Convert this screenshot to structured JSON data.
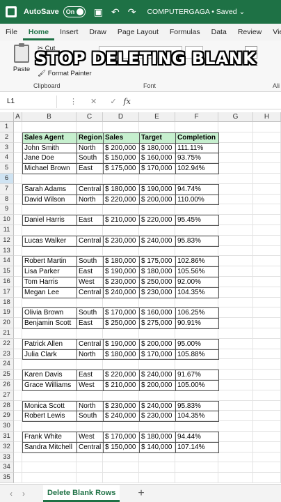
{
  "titlebar": {
    "autosave": "AutoSave",
    "toggle": "On",
    "title": "COMPUTERGAGA • Saved ⌄"
  },
  "menu": {
    "tabs": [
      "File",
      "Home",
      "Insert",
      "Draw",
      "Page Layout",
      "Formulas",
      "Data",
      "Review",
      "View"
    ],
    "active": "Home"
  },
  "ribbon": {
    "paste": "Paste",
    "cut": "Cut",
    "format_painter": "Format Painter",
    "clipboard": "Clipboard",
    "font": "Font",
    "alignment": "Ali",
    "overlay_text": "STOP DELETING BLANK"
  },
  "formula_bar": {
    "name_box": "L1",
    "fx": "fx"
  },
  "columns": [
    "A",
    "B",
    "C",
    "D",
    "E",
    "F",
    "G",
    "H"
  ],
  "headers": [
    "Sales Agent",
    "Region",
    "Sales",
    "Target",
    "Completion"
  ],
  "rows": [
    {
      "n": 1,
      "blank": true
    },
    {
      "n": 2,
      "header": true
    },
    {
      "n": 3,
      "agent": "John Smith",
      "region": "North",
      "sales": "$ 200,000",
      "target": "$ 180,000",
      "completion": "111.11%"
    },
    {
      "n": 4,
      "agent": "Jane Doe",
      "region": "South",
      "sales": "$ 150,000",
      "target": "$ 160,000",
      "completion": "93.75%"
    },
    {
      "n": 5,
      "agent": "Michael Brown",
      "region": "East",
      "sales": "$ 175,000",
      "target": "$ 170,000",
      "completion": "102.94%"
    },
    {
      "n": 6,
      "blank": true
    },
    {
      "n": 7,
      "agent": "Sarah Adams",
      "region": "Central",
      "sales": "$ 180,000",
      "target": "$ 190,000",
      "completion": "94.74%"
    },
    {
      "n": 8,
      "agent": "David Wilson",
      "region": "North",
      "sales": "$ 220,000",
      "target": "$ 200,000",
      "completion": "110.00%"
    },
    {
      "n": 9,
      "blank": true
    },
    {
      "n": 10,
      "agent": "Daniel Harris",
      "region": "East",
      "sales": "$ 210,000",
      "target": "$ 220,000",
      "completion": "95.45%"
    },
    {
      "n": 11,
      "blank": true
    },
    {
      "n": 12,
      "agent": "Lucas Walker",
      "region": "Central",
      "sales": "$ 230,000",
      "target": "$ 240,000",
      "completion": "95.83%"
    },
    {
      "n": 13,
      "blank": true
    },
    {
      "n": 14,
      "agent": "Robert Martin",
      "region": "South",
      "sales": "$ 180,000",
      "target": "$ 175,000",
      "completion": "102.86%"
    },
    {
      "n": 15,
      "agent": "Lisa Parker",
      "region": "East",
      "sales": "$ 190,000",
      "target": "$ 180,000",
      "completion": "105.56%"
    },
    {
      "n": 16,
      "agent": "Tom Harris",
      "region": "West",
      "sales": "$ 230,000",
      "target": "$ 250,000",
      "completion": "92.00%"
    },
    {
      "n": 17,
      "agent": "Megan Lee",
      "region": "Central",
      "sales": "$ 240,000",
      "target": "$ 230,000",
      "completion": "104.35%"
    },
    {
      "n": 18,
      "blank": true
    },
    {
      "n": 19,
      "agent": "Olivia Brown",
      "region": "South",
      "sales": "$ 170,000",
      "target": "$ 160,000",
      "completion": "106.25%"
    },
    {
      "n": 20,
      "agent": "Benjamin Scott",
      "region": "East",
      "sales": "$ 250,000",
      "target": "$ 275,000",
      "completion": "90.91%"
    },
    {
      "n": 21,
      "blank": true
    },
    {
      "n": 22,
      "agent": "Patrick Allen",
      "region": "Central",
      "sales": "$ 190,000",
      "target": "$ 200,000",
      "completion": "95.00%"
    },
    {
      "n": 23,
      "agent": "Julia Clark",
      "region": "North",
      "sales": "$ 180,000",
      "target": "$ 170,000",
      "completion": "105.88%"
    },
    {
      "n": 24,
      "blank": true
    },
    {
      "n": 25,
      "agent": "Karen Davis",
      "region": "East",
      "sales": "$ 220,000",
      "target": "$ 240,000",
      "completion": "91.67%"
    },
    {
      "n": 26,
      "agent": "Grace Williams",
      "region": "West",
      "sales": "$ 210,000",
      "target": "$ 200,000",
      "completion": "105.00%"
    },
    {
      "n": 27,
      "blank": true
    },
    {
      "n": 28,
      "agent": "Monica Scott",
      "region": "North",
      "sales": "$ 230,000",
      "target": "$ 240,000",
      "completion": "95.83%"
    },
    {
      "n": 29,
      "agent": "Robert Lewis",
      "region": "South",
      "sales": "$ 240,000",
      "target": "$ 230,000",
      "completion": "104.35%"
    },
    {
      "n": 30,
      "blank": true
    },
    {
      "n": 31,
      "agent": "Frank White",
      "region": "West",
      "sales": "$ 170,000",
      "target": "$ 180,000",
      "completion": "94.44%"
    },
    {
      "n": 32,
      "agent": "Sandra Mitchell",
      "region": "Central",
      "sales": "$ 150,000",
      "target": "$ 140,000",
      "completion": "107.14%"
    },
    {
      "n": 33,
      "blank": true
    },
    {
      "n": 34,
      "blank": true
    },
    {
      "n": 35,
      "blank": true
    }
  ],
  "selected_row": 6,
  "sheet_tab": "Delete Blank Rows",
  "colors": {
    "brand": "#1e7145",
    "header_fill": "#c6efce"
  }
}
